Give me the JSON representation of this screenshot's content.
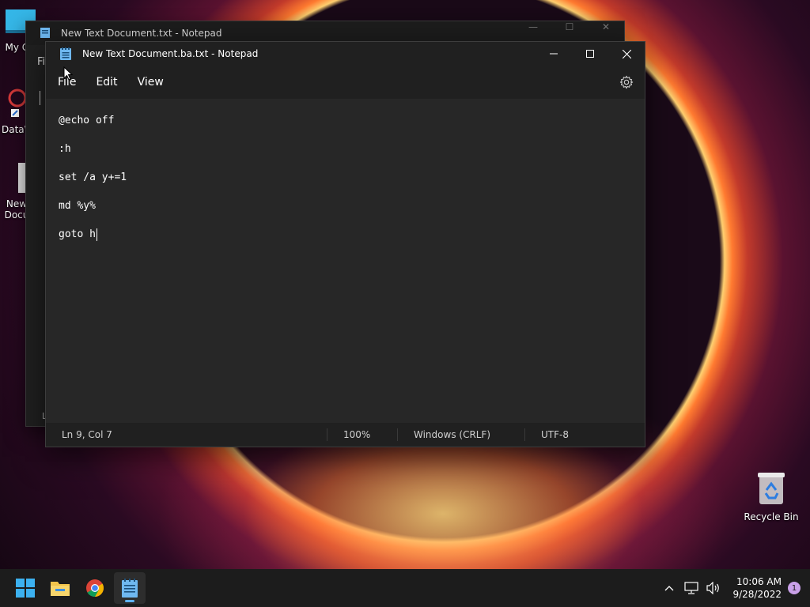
{
  "desktop": {
    "icons": [
      {
        "label": "My Co",
        "icon": "computer-icon"
      },
      {
        "label": "DataW",
        "icon": "app-shortcut-icon"
      },
      {
        "label": "New Docu",
        "icon": "text-file-icon"
      },
      {
        "label": "Recycle Bin",
        "icon": "recycle-bin-icon"
      }
    ]
  },
  "background_window": {
    "title": "New Text Document.txt - Notepad",
    "menu_first": "Fil",
    "status_first": "L"
  },
  "window": {
    "title": "New Text Document.ba.txt - Notepad",
    "menu": {
      "file": "File",
      "edit": "Edit",
      "view": "View"
    },
    "editor_lines": [
      "@echo off",
      ":h",
      "set /a y+=1",
      "md %y%",
      "goto h"
    ],
    "status": {
      "position": "Ln 9, Col 7",
      "zoom": "100%",
      "line_ending": "Windows (CRLF)",
      "encoding": "UTF-8"
    }
  },
  "taskbar": {
    "apps": [
      "start-icon",
      "file-explorer-icon",
      "chrome-icon",
      "notepad-icon"
    ],
    "clock": {
      "time": "10:06 AM",
      "date": "9/28/2022"
    },
    "notification_count": "1"
  },
  "colors": {
    "window_bg": "#272727",
    "titlebar": "#202020",
    "taskbar": "#1c1c1c",
    "accent": "#5fb2f2"
  }
}
